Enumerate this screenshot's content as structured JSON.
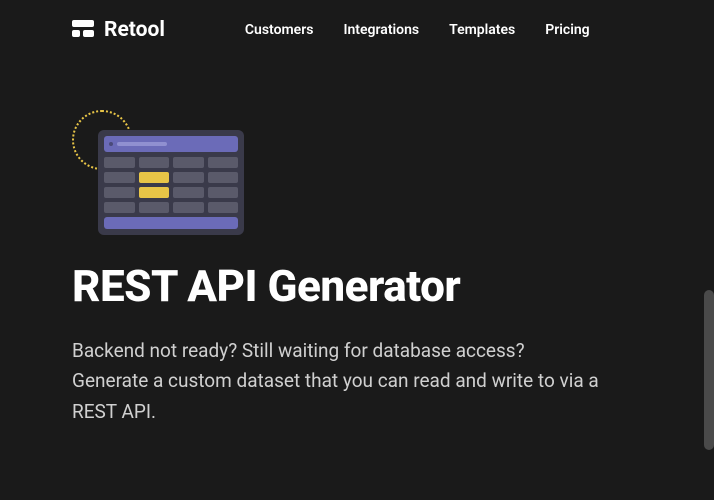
{
  "brand": {
    "name": "Retool"
  },
  "nav": {
    "items": [
      {
        "label": "Customers"
      },
      {
        "label": "Integrations"
      },
      {
        "label": "Templates"
      },
      {
        "label": "Pricing"
      }
    ]
  },
  "hero": {
    "title": "REST API Generator",
    "description": "Backend not ready? Still waiting for database access? Generate a custom dataset that you can read and write to via a REST API."
  }
}
